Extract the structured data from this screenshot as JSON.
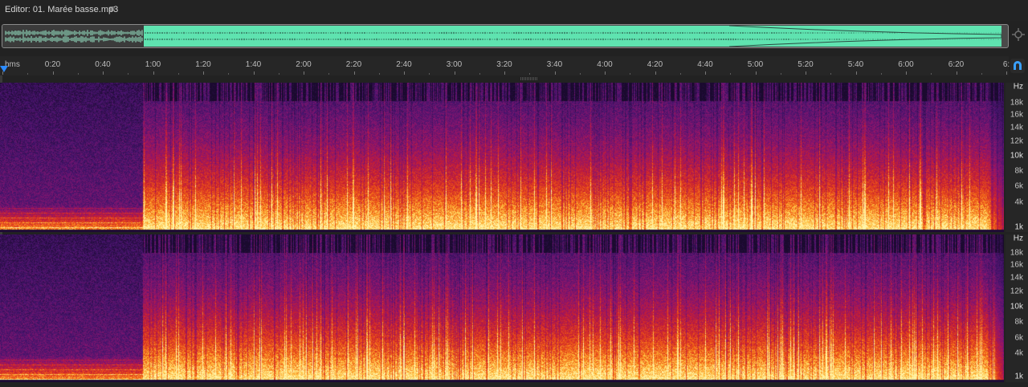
{
  "editor": {
    "title": "Editor: 01. Marée basse.mp3"
  },
  "ruler": {
    "units": "hms",
    "ticks": [
      {
        "label": "0:20",
        "seconds": 20
      },
      {
        "label": "0:40",
        "seconds": 40
      },
      {
        "label": "1:00",
        "seconds": 60
      },
      {
        "label": "1:20",
        "seconds": 80
      },
      {
        "label": "1:40",
        "seconds": 100
      },
      {
        "label": "2:00",
        "seconds": 120
      },
      {
        "label": "2:20",
        "seconds": 140
      },
      {
        "label": "2:40",
        "seconds": 160
      },
      {
        "label": "3:00",
        "seconds": 180
      },
      {
        "label": "3:20",
        "seconds": 200
      },
      {
        "label": "3:40",
        "seconds": 220
      },
      {
        "label": "4:00",
        "seconds": 240
      },
      {
        "label": "4:20",
        "seconds": 260
      },
      {
        "label": "4:40",
        "seconds": 280
      },
      {
        "label": "5:00",
        "seconds": 300
      },
      {
        "label": "5:20",
        "seconds": 320
      },
      {
        "label": "5:40",
        "seconds": 340
      },
      {
        "label": "6:00",
        "seconds": 360
      },
      {
        "label": "6:20",
        "seconds": 380
      },
      {
        "label": "6:",
        "seconds": 400
      }
    ]
  },
  "frequency_scale": {
    "unit_label": "Hz",
    "labels": [
      "18k",
      "16k",
      "14k",
      "12k",
      "10k",
      "8k",
      "6k",
      "4k",
      "1k"
    ]
  },
  "icons": {
    "menu": "hamburger-menu-icon",
    "zoom": "zoom-navigator-icon",
    "snap": "magnet-snap-icon",
    "playhead": "playhead-marker-icon"
  },
  "colors": {
    "background": "#222222",
    "overview_waveform": "#5fe3b0",
    "playhead": "#2d8cff",
    "spectral_low": "#1a0a2e",
    "spectral_mid": "#c8202a",
    "spectral_high": "#ffe680"
  },
  "channels": [
    "left-channel",
    "right-channel"
  ]
}
